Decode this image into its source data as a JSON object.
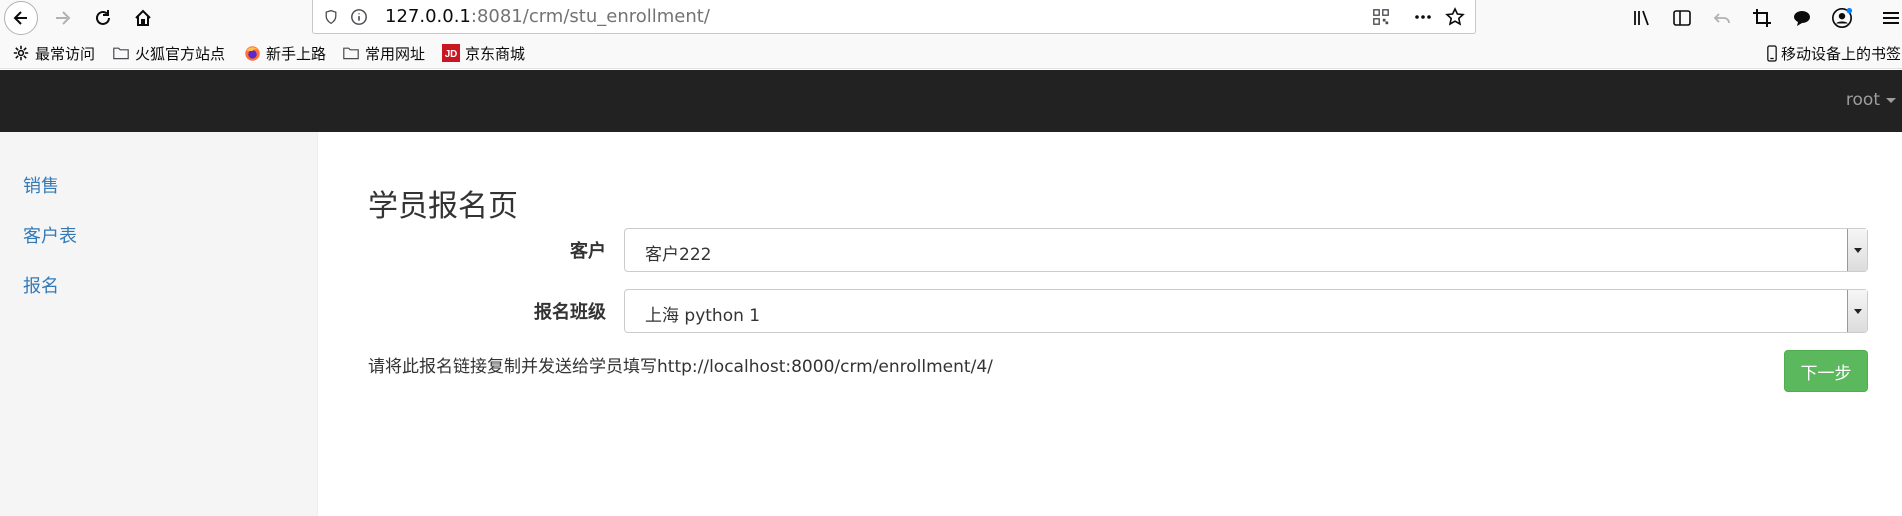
{
  "browser": {
    "url_host": "127.0.0.1",
    "url_rest": ":8081/crm/stu_enrollment/",
    "bookmarks": [
      {
        "label": "最常访问",
        "icon": "gear-icon"
      },
      {
        "label": "火狐官方站点",
        "icon": "folder-icon"
      },
      {
        "label": "新手上路",
        "icon": "firefox-icon"
      },
      {
        "label": "常用网址",
        "icon": "folder-icon"
      },
      {
        "label": "京东商城",
        "icon": "jd-icon"
      }
    ],
    "mobile_bookmarks": "移动设备上的书签",
    "jd_logo_text": "JD"
  },
  "navbar": {
    "user": "root"
  },
  "sidebar": {
    "items": [
      {
        "label": "销售"
      },
      {
        "label": "客户表"
      },
      {
        "label": "报名"
      }
    ]
  },
  "main": {
    "title": "学员报名页",
    "customer_label": "客户",
    "customer_value": "客户222",
    "class_label": "报名班级",
    "class_value": "上海 python 1",
    "hint": "请将此报名链接复制并发送给学员填写http://localhost:8000/crm/enrollment/4/",
    "next_button": "下一步"
  },
  "colors": {
    "navbar_bg": "#222222",
    "link": "#337ab7",
    "success": "#5cb85c"
  }
}
